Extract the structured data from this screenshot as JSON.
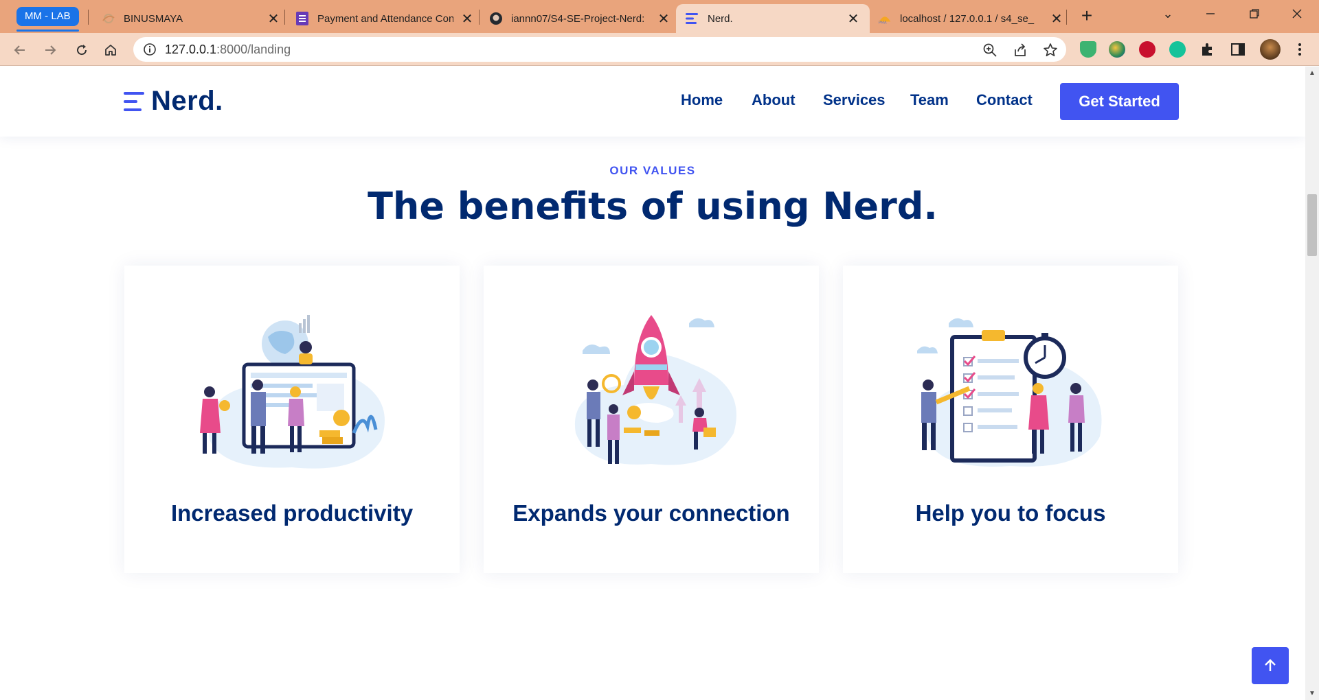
{
  "browser": {
    "tab_group_label": "MM - LAB",
    "tabs": [
      {
        "title": "BINUSMAYA",
        "icon": "binusmaya-icon"
      },
      {
        "title": "Payment and Attendance Con",
        "icon": "forms-icon"
      },
      {
        "title": "iannn07/S4-SE-Project-Nerd:",
        "icon": "github-icon"
      },
      {
        "title": "Nerd.",
        "icon": "nerd-logo-icon",
        "active": true
      },
      {
        "title": "localhost / 127.0.0.1 / s4_se_",
        "icon": "phpmyadmin-icon"
      }
    ],
    "url_host": "127.0.0.1",
    "url_rest": ":8000/landing",
    "new_tab_glyph": "+"
  },
  "header": {
    "logo_text": "Nerd.",
    "nav": [
      "Home",
      "About",
      "Services",
      "Team",
      "Contact"
    ],
    "cta_label": "Get Started"
  },
  "values_section": {
    "eyebrow": "OUR VALUES",
    "heading": "The benefits of using Nerd.",
    "cards": [
      {
        "title": "Increased productivity",
        "illustration": "team-productivity-illustration"
      },
      {
        "title": "Expands your connection",
        "illustration": "rocket-launch-illustration"
      },
      {
        "title": "Help you to focus",
        "illustration": "checklist-focus-illustration"
      }
    ]
  },
  "colors": {
    "brand": "#4154f1",
    "navy": "#012970",
    "tabbar": "#e9a47c",
    "toolbar": "#f6d8c5"
  }
}
